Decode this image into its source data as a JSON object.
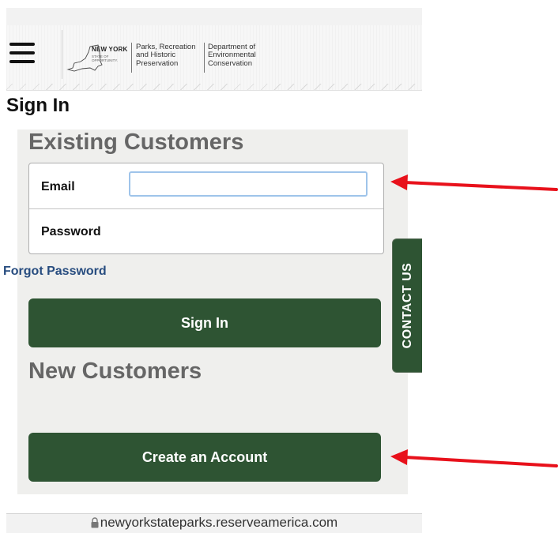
{
  "header": {
    "logo": {
      "line1": "NEW YORK",
      "line2": "STATE OF",
      "line3": "OPPORTUNITY."
    },
    "agency1": {
      "line1": "Parks, Recreation",
      "line2": "and Historic",
      "line3": "Preservation"
    },
    "agency2": {
      "line1": "Department of",
      "line2": "Environmental",
      "line3": "Conservation"
    }
  },
  "page": {
    "title": "Sign In"
  },
  "existing": {
    "title": "Existing Customers",
    "email_label": "Email",
    "email_value": "",
    "password_label": "Password",
    "password_value": "",
    "forgot_label": "Forgot Password",
    "signin_label": "Sign In"
  },
  "newcust": {
    "title": "New Customers",
    "create_label": "Create an Account"
  },
  "contact_tab": {
    "label": "CONTACT US"
  },
  "browser": {
    "url": "newyorkstateparks.reserveamerica.com"
  },
  "colors": {
    "button_green": "#2e5433",
    "link_blue": "#274c7f",
    "annotation_arrow": "#e8111b",
    "focus_border": "#9fc4ea"
  },
  "icons": [
    "menu-icon",
    "ny-state-map-icon",
    "lock-icon",
    "arrow-annotation"
  ]
}
